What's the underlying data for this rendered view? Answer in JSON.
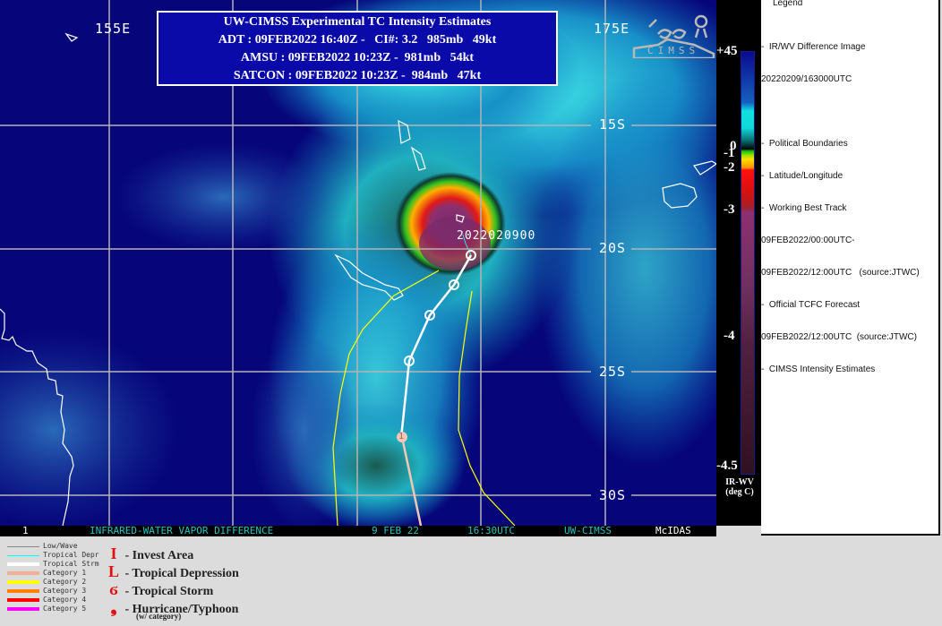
{
  "info_box": {
    "title": "UW-CIMSS Experimental TC Intensity Estimates",
    "lines": [
      "ADT : 09FEB2022 16:40Z -   CI#: 3.2   985mb   49kt",
      "AMSU : 09FEB2022 10:23Z -  981mb   54kt",
      "SATCON : 09FEB2022 10:23Z -  984mb   47kt"
    ]
  },
  "grid_labels": {
    "lon": [
      "155E",
      "175E"
    ],
    "lat": [
      "15S",
      "20S",
      "25S",
      "30S"
    ]
  },
  "storm_label": "2022020900",
  "logo_text": "CIMSS",
  "status_bar": {
    "frame": "1",
    "product": "INFRARED-WATER VAPOR DIFFERENCE",
    "date": "9 FEB 22",
    "time": "16:30UTC",
    "source": "UW-CIMSS",
    "system": "McIDAS"
  },
  "colorbar": {
    "ticks": [
      "+45",
      "0",
      "-1",
      "-2",
      "-3",
      "-4",
      "-4.5"
    ],
    "units_line1": "IR-WV",
    "units_line2": "(deg C)"
  },
  "legend_panel": {
    "title": "Legend",
    "lines": [
      "-  IR/WV Difference Image",
      "20220209/163000UTC",
      "",
      "-  Political Boundaries",
      "-  Latitude/Longitude",
      "-  Working Best Track",
      "09FEB2022/00:00UTC-",
      "09FEB2022/12:00UTC   (source:JTWC)",
      "-  Official TCFC Forecast",
      "09FEB2022/12:00UTC  (source:JTWC)",
      "-  CIMSS Intensity Estimates"
    ]
  },
  "track_legend": [
    {
      "label": "Low/Wave",
      "color": "#888888"
    },
    {
      "label": "Tropical Depr",
      "color": "#00ffff"
    },
    {
      "label": "Tropical Strm",
      "color": "#ffffff"
    },
    {
      "label": "Category 1",
      "color": "#f4b096"
    },
    {
      "label": "Category 2",
      "color": "#ffff00"
    },
    {
      "label": "Category 3",
      "color": "#ff8000"
    },
    {
      "label": "Category 4",
      "color": "#ff0000"
    },
    {
      "label": "Category 5",
      "color": "#ff00ff"
    }
  ],
  "symbol_legend": [
    {
      "symbol": "I",
      "label": "- Invest Area"
    },
    {
      "symbol": "L",
      "label": "- Tropical Depression"
    },
    {
      "symbol": "ϭ",
      "label": "- Tropical Storm"
    },
    {
      "symbol": "❟",
      "label": "- Hurricane/Typhoon"
    }
  ],
  "symbol_note": "(w/ category)",
  "forecast_marker_label": "1"
}
